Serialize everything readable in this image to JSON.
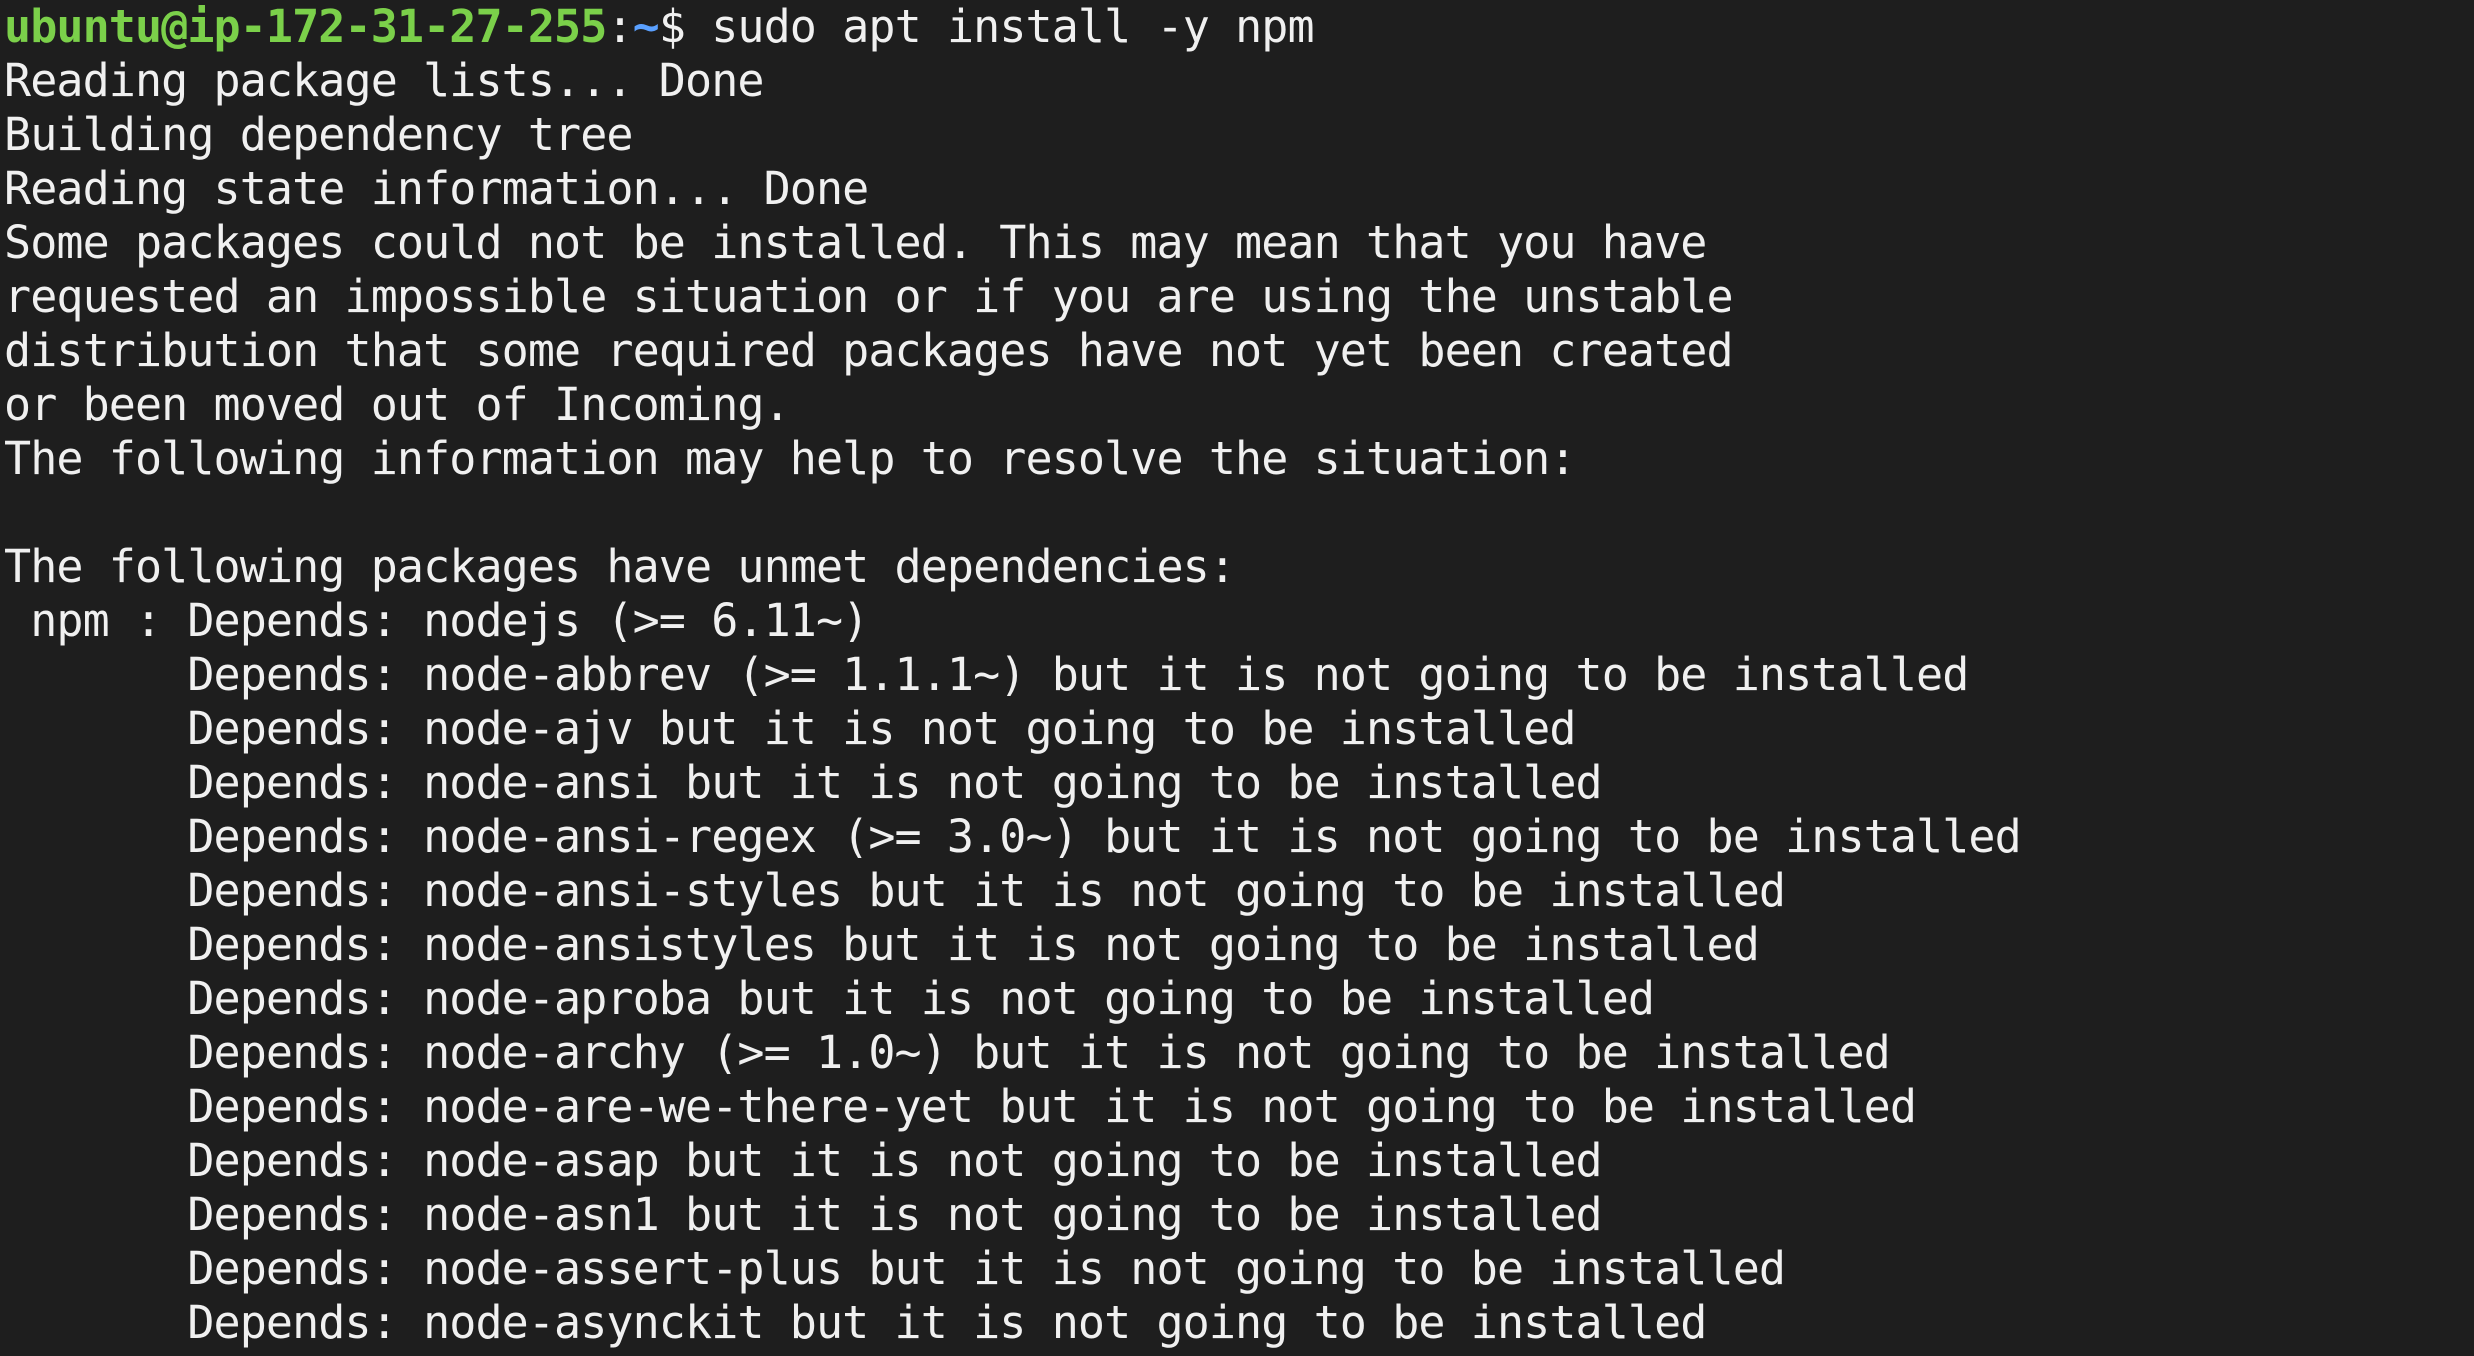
{
  "prompt": {
    "user_host": "ubuntu@ip-172-31-27-255",
    "separator": ":",
    "path": "~",
    "symbol": "$ ",
    "command": "sudo apt install -y npm"
  },
  "output_lines": [
    "Reading package lists... Done",
    "Building dependency tree",
    "Reading state information... Done",
    "Some packages could not be installed. This may mean that you have",
    "requested an impossible situation or if you are using the unstable",
    "distribution that some required packages have not yet been created",
    "or been moved out of Incoming.",
    "The following information may help to resolve the situation:",
    "",
    "The following packages have unmet dependencies:",
    " npm : Depends: nodejs (>= 6.11~)",
    "       Depends: node-abbrev (>= 1.1.1~) but it is not going to be installed",
    "       Depends: node-ajv but it is not going to be installed",
    "       Depends: node-ansi but it is not going to be installed",
    "       Depends: node-ansi-regex (>= 3.0~) but it is not going to be installed",
    "       Depends: node-ansi-styles but it is not going to be installed",
    "       Depends: node-ansistyles but it is not going to be installed",
    "       Depends: node-aproba but it is not going to be installed",
    "       Depends: node-archy (>= 1.0~) but it is not going to be installed",
    "       Depends: node-are-we-there-yet but it is not going to be installed",
    "       Depends: node-asap but it is not going to be installed",
    "       Depends: node-asn1 but it is not going to be installed",
    "       Depends: node-assert-plus but it is not going to be installed",
    "       Depends: node-asynckit but it is not going to be installed"
  ],
  "colors": {
    "background": "#1e1e1e",
    "text": "#f0f0f0",
    "user_host": "#7bd04a",
    "path": "#5aa0ff"
  }
}
